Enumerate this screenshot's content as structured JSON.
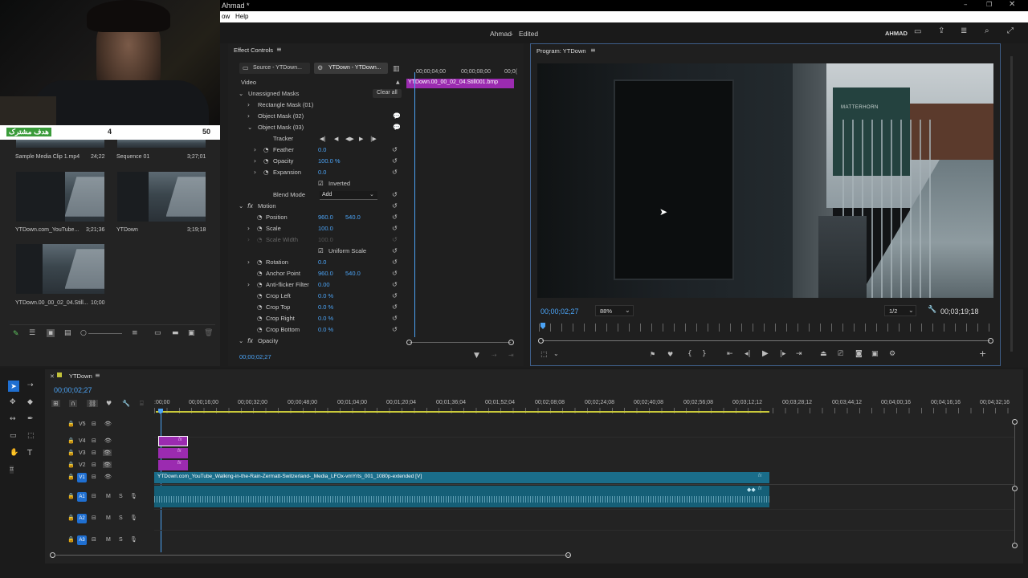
{
  "window": {
    "title": "Ahmad *",
    "menu": [
      "ow",
      "Help"
    ]
  },
  "header": {
    "project_title": "Ahmad",
    "status": "Edited",
    "separator": "-",
    "workspace_user": "AHMAD"
  },
  "webcam_overlay": {
    "label_left": "هدف مشترک",
    "count_mid": "4",
    "count_right": "50"
  },
  "project_panel": {
    "items": [
      {
        "name": "Sample Media Clip 1.mp4",
        "duration": "24;22"
      },
      {
        "name": "Sequence 01",
        "duration": "3;27;01"
      },
      {
        "name": "YTDown.com_YouTube...",
        "duration": "3;21;36"
      },
      {
        "name": "YTDown",
        "duration": "3;19;18"
      },
      {
        "name": "YTDown.00_00_02_04.Still...",
        "duration": "10;00"
      }
    ]
  },
  "effect_controls": {
    "panel_title": "Effect Controls",
    "source_tab": "Source - YTDown...",
    "seq_tab": "YTDown - YTDown...",
    "section_video": "Video",
    "ruler": [
      "00;00;04;00",
      "00;00;08;00",
      "00;0("
    ],
    "clip_label": "YTDown.00_00_02_04.Still001.bmp",
    "clear_all": "Clear all",
    "timecode": "00;00;02;27",
    "rows": {
      "unassigned_masks": "Unassigned Masks",
      "rect_mask": "Rectangle Mask (01)",
      "obj_mask2": "Object Mask (02)",
      "obj_mask3": "Object Mask (03)",
      "tracker": "Tracker",
      "feather": "Feather",
      "feather_val": "0.0",
      "opacity": "Opacity",
      "opacity_val": "100.0 %",
      "expansion": "Expansion",
      "expansion_val": "0.0",
      "inverted": "Inverted",
      "blend_mode": "Blend Mode",
      "blend_mode_val": "Add",
      "motion": "Motion",
      "position": "Position",
      "position_x": "960.0",
      "position_y": "540.0",
      "scale": "Scale",
      "scale_val": "100.0",
      "scale_width": "Scale Width",
      "scale_width_val": "100.0",
      "uniform_scale": "Uniform Scale",
      "rotation": "Rotation",
      "rotation_val": "0.0",
      "anchor_point": "Anchor Point",
      "anchor_x": "960.0",
      "anchor_y": "540.0",
      "anti_flicker": "Anti-flicker Filter",
      "anti_flicker_val": "0.00",
      "crop_left": "Crop Left",
      "crop_left_val": "0.0 %",
      "crop_top": "Crop Top",
      "crop_top_val": "0.0 %",
      "crop_right": "Crop Right",
      "crop_right_val": "0.0 %",
      "crop_bottom": "Crop Bottom",
      "crop_bottom_val": "0.0 %",
      "opacity_section": "Opacity"
    }
  },
  "program_monitor": {
    "title": "Program: YTDown",
    "timecode": "00;00;02;27",
    "zoom": "88%",
    "resolution": "1/2",
    "duration": "00;03;19;18",
    "sign_text": "MATTERHORN"
  },
  "timeline": {
    "sequence_tab": "YTDown",
    "timecode": "00;00;02;27",
    "ruler": [
      ":00;00",
      "00;00;16;00",
      "00;00;32;00",
      "00;00;48;00",
      "00;01;04;00",
      "00;01;20;04",
      "00;01;36;04",
      "00;01;52;04",
      "00;02;08;08",
      "00;02;24;08",
      "00;02;40;08",
      "00;02;56;08",
      "00;03;12;12",
      "00;03;28;12",
      "00;03;44;12",
      "00;04;00;16",
      "00;04;16;16",
      "00;04;32;16"
    ],
    "video_tracks": [
      "V5",
      "V4",
      "V3",
      "V2",
      "V1"
    ],
    "audio_tracks": [
      "A1",
      "A2",
      "A3"
    ],
    "track_toggle_m": "M",
    "track_toggle_s": "S",
    "v1_clip": "YTDown.com_YouTube_Walking-in-the-Rain-Zermatt-Switzerland-_Media_LFOx-vmYrts_001_1080p-extended [V]",
    "fx_label": "fx"
  },
  "colors": {
    "accent_blue": "#4ba3f5",
    "track_active": "#1f6fd1",
    "clip_video": "#1a6d8a",
    "clip_purple": "#9b2bb0"
  }
}
